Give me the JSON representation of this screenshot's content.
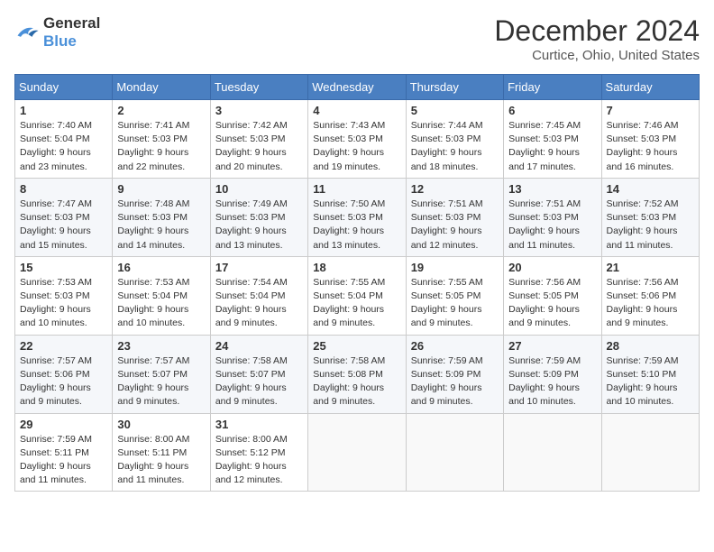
{
  "header": {
    "logo_line1": "General",
    "logo_line2": "Blue",
    "month": "December 2024",
    "location": "Curtice, Ohio, United States"
  },
  "days_of_week": [
    "Sunday",
    "Monday",
    "Tuesday",
    "Wednesday",
    "Thursday",
    "Friday",
    "Saturday"
  ],
  "weeks": [
    [
      {
        "day": "1",
        "sunrise": "7:40 AM",
        "sunset": "5:04 PM",
        "daylight": "9 hours and 23 minutes."
      },
      {
        "day": "2",
        "sunrise": "7:41 AM",
        "sunset": "5:03 PM",
        "daylight": "9 hours and 22 minutes."
      },
      {
        "day": "3",
        "sunrise": "7:42 AM",
        "sunset": "5:03 PM",
        "daylight": "9 hours and 20 minutes."
      },
      {
        "day": "4",
        "sunrise": "7:43 AM",
        "sunset": "5:03 PM",
        "daylight": "9 hours and 19 minutes."
      },
      {
        "day": "5",
        "sunrise": "7:44 AM",
        "sunset": "5:03 PM",
        "daylight": "9 hours and 18 minutes."
      },
      {
        "day": "6",
        "sunrise": "7:45 AM",
        "sunset": "5:03 PM",
        "daylight": "9 hours and 17 minutes."
      },
      {
        "day": "7",
        "sunrise": "7:46 AM",
        "sunset": "5:03 PM",
        "daylight": "9 hours and 16 minutes."
      }
    ],
    [
      {
        "day": "8",
        "sunrise": "7:47 AM",
        "sunset": "5:03 PM",
        "daylight": "9 hours and 15 minutes."
      },
      {
        "day": "9",
        "sunrise": "7:48 AM",
        "sunset": "5:03 PM",
        "daylight": "9 hours and 14 minutes."
      },
      {
        "day": "10",
        "sunrise": "7:49 AM",
        "sunset": "5:03 PM",
        "daylight": "9 hours and 13 minutes."
      },
      {
        "day": "11",
        "sunrise": "7:50 AM",
        "sunset": "5:03 PM",
        "daylight": "9 hours and 13 minutes."
      },
      {
        "day": "12",
        "sunrise": "7:51 AM",
        "sunset": "5:03 PM",
        "daylight": "9 hours and 12 minutes."
      },
      {
        "day": "13",
        "sunrise": "7:51 AM",
        "sunset": "5:03 PM",
        "daylight": "9 hours and 11 minutes."
      },
      {
        "day": "14",
        "sunrise": "7:52 AM",
        "sunset": "5:03 PM",
        "daylight": "9 hours and 11 minutes."
      }
    ],
    [
      {
        "day": "15",
        "sunrise": "7:53 AM",
        "sunset": "5:03 PM",
        "daylight": "9 hours and 10 minutes."
      },
      {
        "day": "16",
        "sunrise": "7:53 AM",
        "sunset": "5:04 PM",
        "daylight": "9 hours and 10 minutes."
      },
      {
        "day": "17",
        "sunrise": "7:54 AM",
        "sunset": "5:04 PM",
        "daylight": "9 hours and 9 minutes."
      },
      {
        "day": "18",
        "sunrise": "7:55 AM",
        "sunset": "5:04 PM",
        "daylight": "9 hours and 9 minutes."
      },
      {
        "day": "19",
        "sunrise": "7:55 AM",
        "sunset": "5:05 PM",
        "daylight": "9 hours and 9 minutes."
      },
      {
        "day": "20",
        "sunrise": "7:56 AM",
        "sunset": "5:05 PM",
        "daylight": "9 hours and 9 minutes."
      },
      {
        "day": "21",
        "sunrise": "7:56 AM",
        "sunset": "5:06 PM",
        "daylight": "9 hours and 9 minutes."
      }
    ],
    [
      {
        "day": "22",
        "sunrise": "7:57 AM",
        "sunset": "5:06 PM",
        "daylight": "9 hours and 9 minutes."
      },
      {
        "day": "23",
        "sunrise": "7:57 AM",
        "sunset": "5:07 PM",
        "daylight": "9 hours and 9 minutes."
      },
      {
        "day": "24",
        "sunrise": "7:58 AM",
        "sunset": "5:07 PM",
        "daylight": "9 hours and 9 minutes."
      },
      {
        "day": "25",
        "sunrise": "7:58 AM",
        "sunset": "5:08 PM",
        "daylight": "9 hours and 9 minutes."
      },
      {
        "day": "26",
        "sunrise": "7:59 AM",
        "sunset": "5:09 PM",
        "daylight": "9 hours and 9 minutes."
      },
      {
        "day": "27",
        "sunrise": "7:59 AM",
        "sunset": "5:09 PM",
        "daylight": "9 hours and 10 minutes."
      },
      {
        "day": "28",
        "sunrise": "7:59 AM",
        "sunset": "5:10 PM",
        "daylight": "9 hours and 10 minutes."
      }
    ],
    [
      {
        "day": "29",
        "sunrise": "7:59 AM",
        "sunset": "5:11 PM",
        "daylight": "9 hours and 11 minutes."
      },
      {
        "day": "30",
        "sunrise": "8:00 AM",
        "sunset": "5:11 PM",
        "daylight": "9 hours and 11 minutes."
      },
      {
        "day": "31",
        "sunrise": "8:00 AM",
        "sunset": "5:12 PM",
        "daylight": "9 hours and 12 minutes."
      },
      null,
      null,
      null,
      null
    ]
  ]
}
